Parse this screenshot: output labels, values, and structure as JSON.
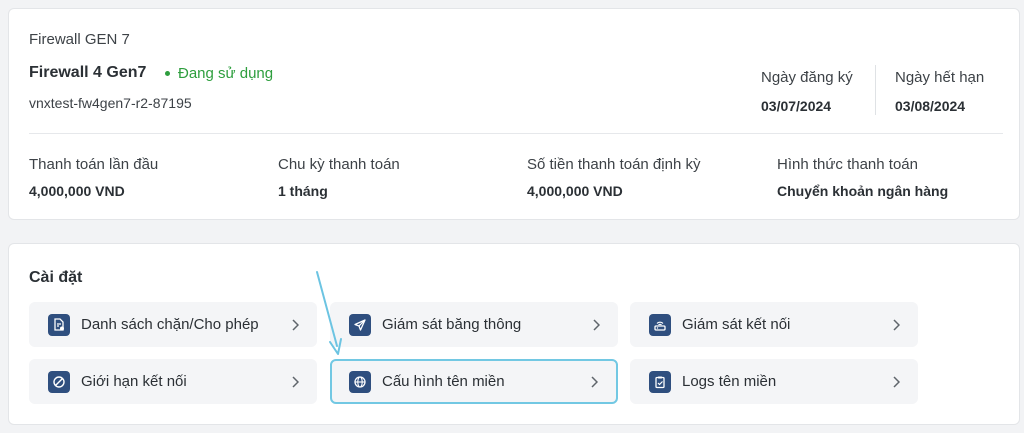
{
  "service": {
    "product_type": "Firewall GEN 7",
    "name": "Firewall 4 Gen7",
    "status": "Đang sử dụng",
    "hostname": "vnxtest-fw4gen7-r2-87195",
    "status_color": "#2e9e3e"
  },
  "dates": {
    "registered_label": "Ngày đăng ký",
    "registered_value": "03/07/2024",
    "expiry_label": "Ngày hết hạn",
    "expiry_value": "03/08/2024"
  },
  "billing": [
    {
      "label": "Thanh toán lần đầu",
      "value": "4,000,000 VND"
    },
    {
      "label": "Chu kỳ thanh toán",
      "value": "1 tháng"
    },
    {
      "label": "Số tiền thanh toán định kỳ",
      "value": "4,000,000 VND"
    },
    {
      "label": "Hình thức thanh toán",
      "value": "Chuyển khoản ngân hàng"
    }
  ],
  "settings": {
    "title": "Cài đặt",
    "items": [
      {
        "label": "Danh sách chặn/Cho phép",
        "icon": "document-shield-icon"
      },
      {
        "label": "Giám sát băng thông",
        "icon": "send-icon"
      },
      {
        "label": "Giám sát kết nối",
        "icon": "router-icon"
      },
      {
        "label": "Giới hạn kết nối",
        "icon": "block-icon"
      },
      {
        "label": "Cấu hình tên miền",
        "icon": "globe-icon",
        "highlighted": true
      },
      {
        "label": "Logs tên miền",
        "icon": "clipboard-check-icon"
      }
    ]
  },
  "colors": {
    "icon_bg": "#2f4f7f",
    "highlight_border": "#72c8e3",
    "arrow": "#6cc4e2"
  }
}
